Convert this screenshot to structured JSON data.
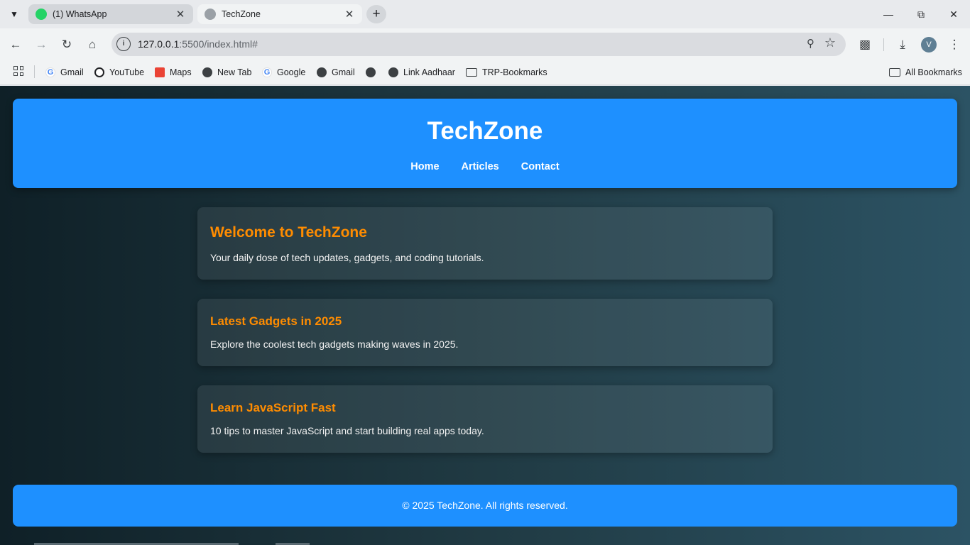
{
  "browser": {
    "tabs": [
      {
        "title": "(1) WhatsApp",
        "favicon": "whatsapp-icon",
        "active": false
      },
      {
        "title": "TechZone",
        "favicon": "globe-icon",
        "active": true
      }
    ],
    "url_host": "127.0.0.1",
    "url_rest": ":5500/index.html#",
    "profile_initial": "V",
    "bookmarks": [
      {
        "label": "Gmail",
        "icon": "google-icon"
      },
      {
        "label": "YouTube",
        "icon": "power-icon"
      },
      {
        "label": "Maps",
        "icon": "maps-icon"
      },
      {
        "label": "New Tab",
        "icon": "globe-icon"
      },
      {
        "label": "Google",
        "icon": "google-icon"
      },
      {
        "label": "Gmail",
        "icon": "globe-icon"
      },
      {
        "label": "",
        "icon": "globe-icon"
      },
      {
        "label": "Link Aadhaar",
        "icon": "globe-icon"
      },
      {
        "label": "TRP-Bookmarks",
        "icon": "folder-icon"
      }
    ],
    "all_bookmarks": "All Bookmarks",
    "colors": {
      "chrome_bg": "#f1f3f4",
      "tabstrip_bg": "#e8eaed"
    }
  },
  "site": {
    "title": "TechZone",
    "nav": [
      "Home",
      "Articles",
      "Contact"
    ],
    "hero": {
      "heading": "Welcome to TechZone",
      "text": "Your daily dose of tech updates, gadgets, and coding tutorials."
    },
    "articles": [
      {
        "title": "Latest Gadgets in 2025",
        "summary": "Explore the coolest tech gadgets making waves in 2025."
      },
      {
        "title": "Learn JavaScript Fast",
        "summary": "10 tips to master JavaScript and start building real apps today."
      }
    ],
    "footer": "© 2025 TechZone. All rights reserved.",
    "colors": {
      "accent": "#1e90ff",
      "heading": "#ff8c00",
      "bg_start": "#0f2027",
      "bg_end": "#2c5364"
    }
  }
}
